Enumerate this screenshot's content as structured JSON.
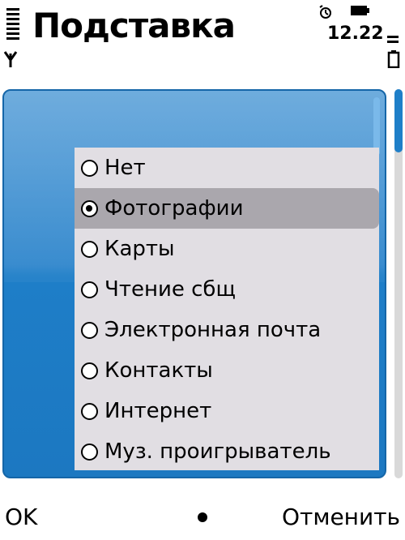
{
  "status_bar": {
    "title": "Подставка",
    "time": "12.22",
    "icons": [
      "signal-strength-icon",
      "antenna-icon",
      "alarm-clock-icon",
      "battery-icon"
    ]
  },
  "list": {
    "selected_index": 1,
    "options": [
      {
        "label": "Нет",
        "selected": false
      },
      {
        "label": "Фотографии",
        "selected": true
      },
      {
        "label": "Карты",
        "selected": false
      },
      {
        "label": "Чтение сбщ",
        "selected": false
      },
      {
        "label": "Электронная почта",
        "selected": false
      },
      {
        "label": "Контакты",
        "selected": false
      },
      {
        "label": "Интернет",
        "selected": false
      },
      {
        "label": "Муз. проигрыватель",
        "selected": false
      }
    ]
  },
  "softkeys": {
    "left": "OK",
    "right": "Отменить"
  },
  "colors": {
    "accent": "#1f7fc8",
    "highlight": "#aaa7ad",
    "list_bg": "#e1dee3"
  }
}
